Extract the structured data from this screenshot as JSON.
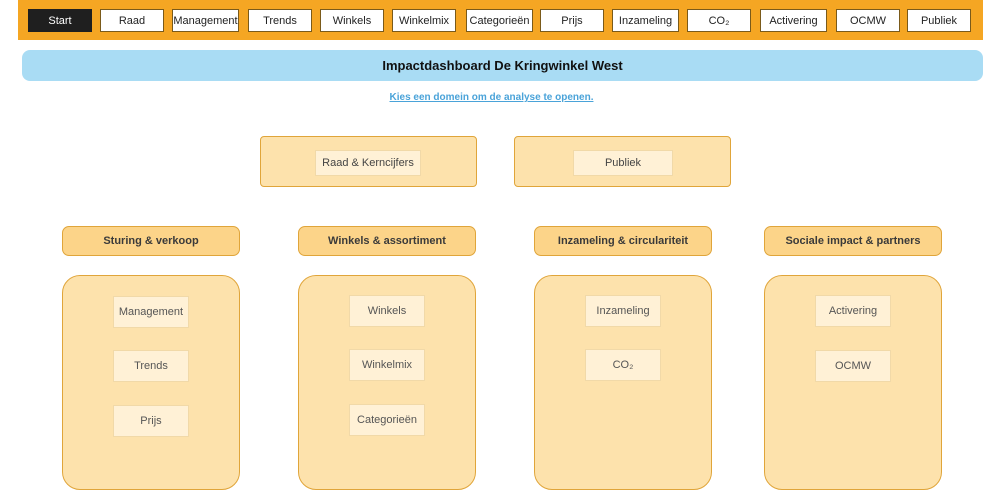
{
  "nav": {
    "items": [
      "Start",
      "Raad",
      "Management",
      "Trends",
      "Winkels",
      "Winkelmix",
      "Categorieën",
      "Prijs",
      "Inzameling",
      "CO₂",
      "Activering",
      "OCMW",
      "Publiek"
    ],
    "active": "Start"
  },
  "title": "Impactdashboard De Kringwinkel West",
  "subtitle": "Kies een domein om de analyse te openen.",
  "top_panels": {
    "raad": "Raad & Kerncijfers",
    "publiek": "Publiek"
  },
  "groups": [
    {
      "header": "Sturing & verkoop",
      "items": [
        "Management",
        "Trends",
        "Prijs"
      ]
    },
    {
      "header": "Winkels & assortiment",
      "items": [
        "Winkels",
        "Winkelmix",
        "Categorieën"
      ]
    },
    {
      "header": "Inzameling & circulariteit",
      "items": [
        "Inzameling",
        "CO₂"
      ]
    },
    {
      "header": "Sociale impact & partners",
      "items": [
        "Activering",
        "OCMW"
      ]
    }
  ],
  "colors": {
    "nav_bar": "#f5a623",
    "title_bar": "#a9dcf4",
    "panel": "#fde2ac",
    "group_header": "#fcd489",
    "link": "#4aa3d9"
  }
}
